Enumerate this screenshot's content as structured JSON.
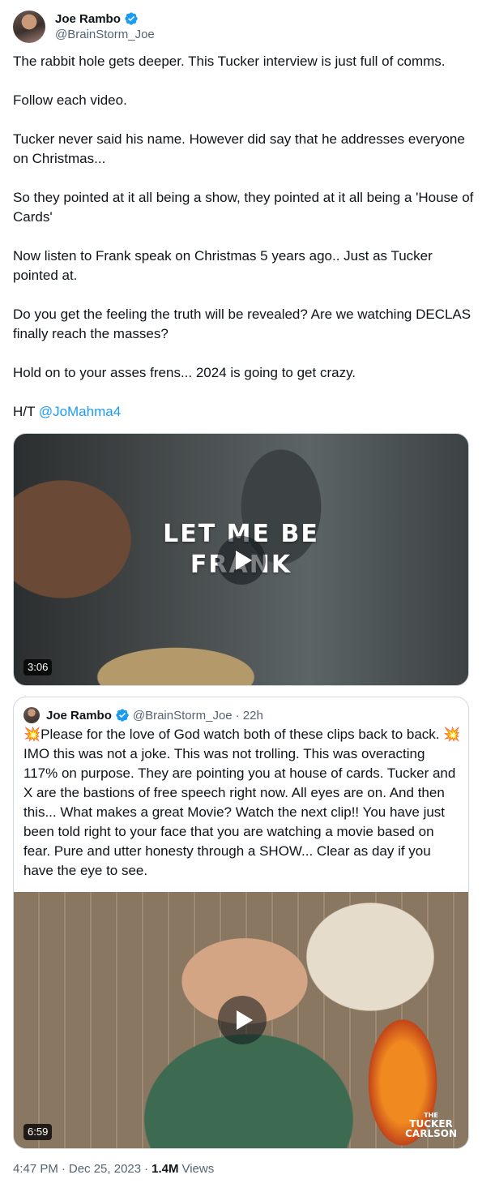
{
  "author": {
    "display_name": "Joe Rambo",
    "handle": "@BrainStorm_Joe"
  },
  "tweet": {
    "paragraphs": [
      "The rabbit hole gets deeper.  This Tucker interview is just full of comms.",
      "Follow each video.",
      "Tucker never said his name.  However did say that he addresses everyone on Christmas...",
      "So they pointed at it all being a show, they pointed at it all being a 'House of Cards'",
      "Now listen to Frank speak on Christmas 5 years ago.. Just as Tucker pointed at.",
      "Do you get the feeling the truth will be revealed?   Are we watching DECLAS finally reach the masses?",
      "Hold on to your asses frens... 2024 is going to get crazy."
    ],
    "ht_prefix": "H/T",
    "ht_mention": "@JoMahma4"
  },
  "video1": {
    "overlay_line1": "LET ME BE",
    "overlay_line2": "FRANK",
    "duration": "3:06"
  },
  "quote": {
    "display_name": "Joe Rambo",
    "handle": "@BrainStorm_Joe",
    "time": "· 22h",
    "text": "💥Please for the love of God watch both of these clips back to back. 💥 IMO this was not a joke. This was not trolling. This was overacting 117% on purpose. They are pointing you at house of cards. Tucker and X are the bastions of free speech right now. All eyes are on. And then this... What makes a great Movie? Watch the next clip!! You have just been told right to your face that you are watching a movie based on fear. Pure and utter honesty through a SHOW... Clear as day if you have the eye to see.",
    "video": {
      "duration": "6:59",
      "logo_line1": "THE",
      "logo_line2": "TUCKER",
      "logo_line3": "CARLSON"
    }
  },
  "footer": {
    "time": "4:47 PM",
    "separator1": "·",
    "date": "Dec 25, 2023",
    "separator2": "·",
    "views_count": "1.4M",
    "views_label": "Views"
  },
  "icons": {
    "verified": "verified-badge-icon",
    "play": "play-icon"
  },
  "colors": {
    "accent": "#1d9bf0",
    "secondary_text": "#536471"
  }
}
